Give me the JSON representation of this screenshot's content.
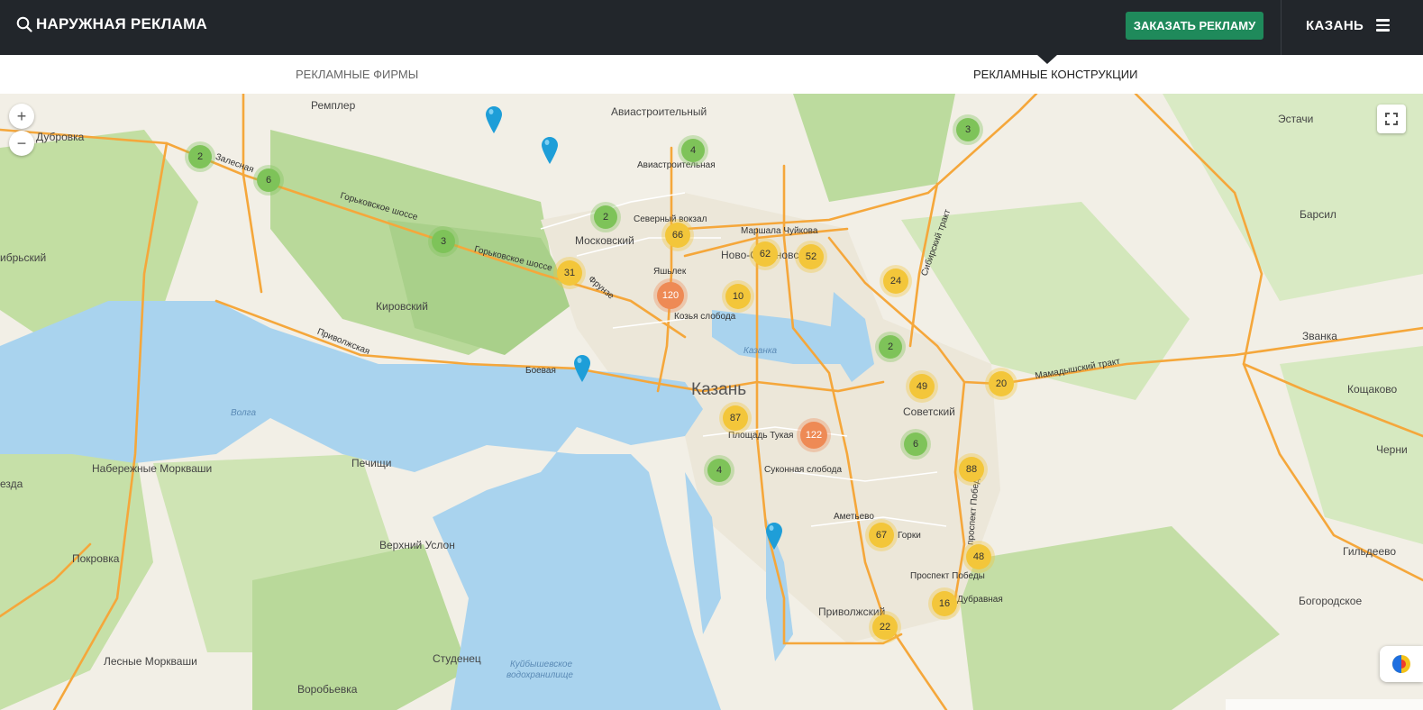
{
  "header": {
    "title": "НАРУЖНАЯ РЕКЛАМА",
    "cta_label": "ЗАКАЗАТЬ РЕКЛАМУ",
    "city": "КАЗАНЬ"
  },
  "tabs": [
    {
      "label": "РЕКЛАМНЫЕ ФИРМЫ",
      "active": false
    },
    {
      "label": "РЕКЛАМНЫЕ КОНСТРУКЦИИ",
      "active": true
    }
  ],
  "map": {
    "zoom_in_label": "+",
    "zoom_out_label": "−",
    "places": {
      "rempler": "Ремплер",
      "dubrovka": "Дубровка",
      "aviastroitelny": "Авиастроительный",
      "aviastroitelnaya": "Авиастроительная",
      "severny_pokzal": "Северный вокзал",
      "moskovsky": "Московский",
      "marshala_chuikova": "Маршала Чуйкова",
      "novo_savinovsky": "Ново-Савиновский",
      "yashlek": "Яшьлек",
      "kozya_sloboda": "Козья слобода",
      "kirovsky": "Кировский",
      "kazanka": "Казанка",
      "kazan": "Казань",
      "ploshad_tukaya": "Площадь Тукая",
      "sukonnaya_sloboda": "Суконная слобода",
      "ametyevo": "Аметьево",
      "gorki": "Горки",
      "prospekt_pobedy": "Проспект Победы",
      "dubravnaya": "Дубравная",
      "privolzhsky": "Приволжский",
      "sovetsky": "Советский",
      "estachi": "Эстачи",
      "barsil": "Барсил",
      "zvanka": "Званка",
      "koshchakovo": "Кощаково",
      "cherni": "Черни",
      "gildeevo": "Гильдеево",
      "bogorodskoe": "Богородское",
      "naberezhnye_morkvashi": "Набережные Моркваши",
      "pechishchi": "Печищи",
      "verkhny_uslon": "Верхний Услон",
      "pokrovka": "Покровка",
      "studenets": "Студенец",
      "lesnye_morkvashi": "Лесные Моркваши",
      "vorobyevka": "Воробьевка",
      "volga": "Волга",
      "kuybyshev1": "Куйбышевское",
      "kuybyshev2": "водохранилище",
      "ezda": "езда",
      "obrsky": "ибрьский",
      "boevaya": "Боевая",
      "zalesnaya": "Залесная",
      "gorkovskoe1": "Горьковское шоссе",
      "gorkovskoe2": "Горьковское шоссе",
      "frunze": "Фрунзе",
      "privolzhskaya": "Приволжская",
      "mamadysh": "Мамадышский тракт",
      "sibirsky": "Сибирский тракт",
      "prospekt": "проспект Победы"
    },
    "clusters": [
      {
        "count": 2,
        "color": "green"
      },
      {
        "count": 6,
        "color": "green"
      },
      {
        "count": 3,
        "color": "green"
      },
      {
        "count": 4,
        "color": "green"
      },
      {
        "count": 2,
        "color": "green"
      },
      {
        "count": 66,
        "color": "yellow"
      },
      {
        "count": 31,
        "color": "yellow"
      },
      {
        "count": 120,
        "color": "orange"
      },
      {
        "count": 10,
        "color": "yellow"
      },
      {
        "count": 62,
        "color": "yellow"
      },
      {
        "count": 52,
        "color": "yellow"
      },
      {
        "count": 3,
        "color": "green"
      },
      {
        "count": 24,
        "color": "yellow"
      },
      {
        "count": 2,
        "color": "green"
      },
      {
        "count": 49,
        "color": "yellow"
      },
      {
        "count": 20,
        "color": "yellow"
      },
      {
        "count": 87,
        "color": "yellow"
      },
      {
        "count": 122,
        "color": "orange"
      },
      {
        "count": 6,
        "color": "green"
      },
      {
        "count": 4,
        "color": "green"
      },
      {
        "count": 88,
        "color": "yellow"
      },
      {
        "count": 67,
        "color": "yellow"
      },
      {
        "count": 48,
        "color": "yellow"
      },
      {
        "count": 16,
        "color": "yellow"
      },
      {
        "count": 22,
        "color": "yellow"
      }
    ],
    "pin_color": "#1e9ed8"
  },
  "colors": {
    "header_bg": "#22262b",
    "cta_bg": "#1f8a5b",
    "water": "#a9d3ee",
    "forest": "#b9d99a",
    "road": "#f5a73b"
  }
}
